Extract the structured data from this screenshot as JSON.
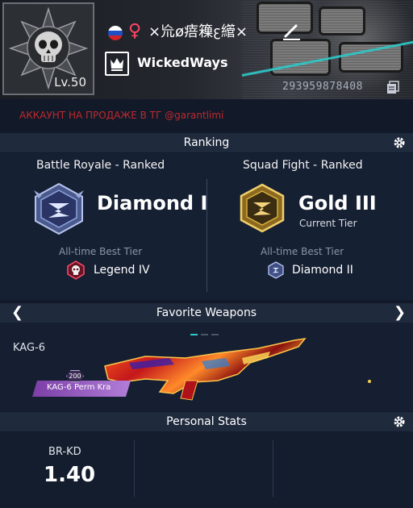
{
  "profile": {
    "level": "Lv.50",
    "gender_symbol": "♀",
    "nickname": "×㠩ø㾦䉓ꜫ䌣×",
    "clan_name": "WickedWays",
    "uid": "293959878408",
    "flag": "russia-flag",
    "icons": [
      "skull-emblem-icon",
      "female-icon",
      "edit-pen-icon",
      "clan-crown-icon",
      "copy-icon"
    ]
  },
  "sale_notice": "АККАУНТ НА ПРОДАЖЕ В ТГ @garantlimi",
  "ranking": {
    "title": "Ranking",
    "battle_royale": {
      "mode": "Battle Royale - Ranked",
      "tier": "Diamond I",
      "best_label": "All-time Best Tier",
      "best_tier": "Legend IV"
    },
    "squad_fight": {
      "mode": "Squad Fight - Ranked",
      "tier": "Gold III",
      "tier_note": "Current Tier",
      "best_label": "All-time Best Tier",
      "best_tier": "Diamond II"
    }
  },
  "weapons": {
    "title": "Favorite Weapons",
    "prev_arrow": "❮",
    "next_arrow": "❯",
    "weapon_name": "KAG-6",
    "skin_label": "KAG-6 Perm Kra",
    "skin_level": "200"
  },
  "stats": {
    "title": "Personal Stats",
    "br_kd_label": "BR-KD",
    "br_kd_value": "1.40"
  },
  "colors": {
    "accent": "#2fc9c9",
    "sale_text": "#c0282c",
    "gender": "#ff4766",
    "section_bar": "#1f2a3d",
    "background": "#121a2a"
  }
}
